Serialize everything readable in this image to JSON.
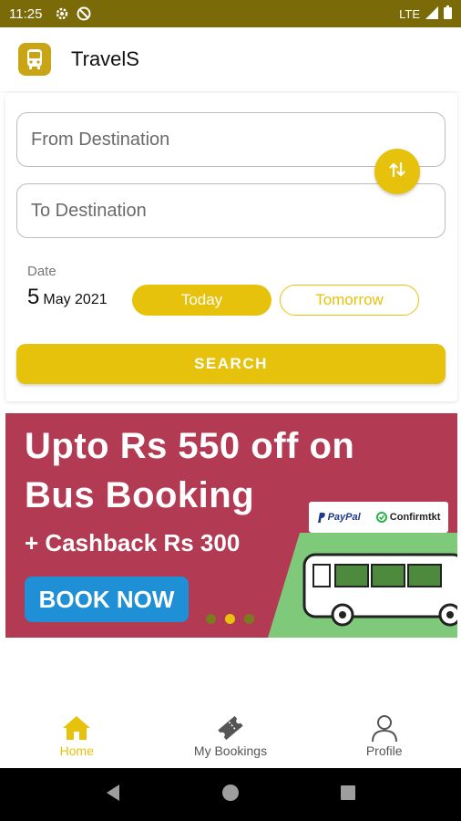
{
  "status_bar": {
    "time": "11:25",
    "network": "LTE",
    "icons": [
      "settings-icon",
      "no-disturb-icon",
      "signal-icon",
      "battery-icon"
    ]
  },
  "app_bar": {
    "title": "TravelS",
    "logo_icon": "bus-logo-icon"
  },
  "search_form": {
    "from_placeholder": "From Destination",
    "to_placeholder": "To Destination",
    "swap_icon": "swap-vertical-icon",
    "date_label": "Date",
    "date_day": "5",
    "date_month_year": "May 2021",
    "today_label": "Today",
    "tomorrow_label": "Tomorrow",
    "search_label": "SEARCH"
  },
  "banner": {
    "headline_line1": "Upto Rs 550 off on",
    "headline_line2": "Bus Booking",
    "cashback": "+ Cashback Rs 300",
    "cta": "BOOK NOW",
    "partner1": "PayPal",
    "partner2": "Confirmtkt",
    "carousel_pages": 3,
    "carousel_active": 2
  },
  "bottom_nav": {
    "items": [
      {
        "label": "Home",
        "icon": "home-icon",
        "active": true
      },
      {
        "label": "My Bookings",
        "icon": "ticket-icon",
        "active": false
      },
      {
        "label": "Profile",
        "icon": "person-icon",
        "active": false
      }
    ]
  },
  "colors": {
    "accent": "#e7c20c",
    "status_bar": "#7b6a08",
    "banner_bg": "#b23a53",
    "cta_blue": "#1f8fd6"
  }
}
